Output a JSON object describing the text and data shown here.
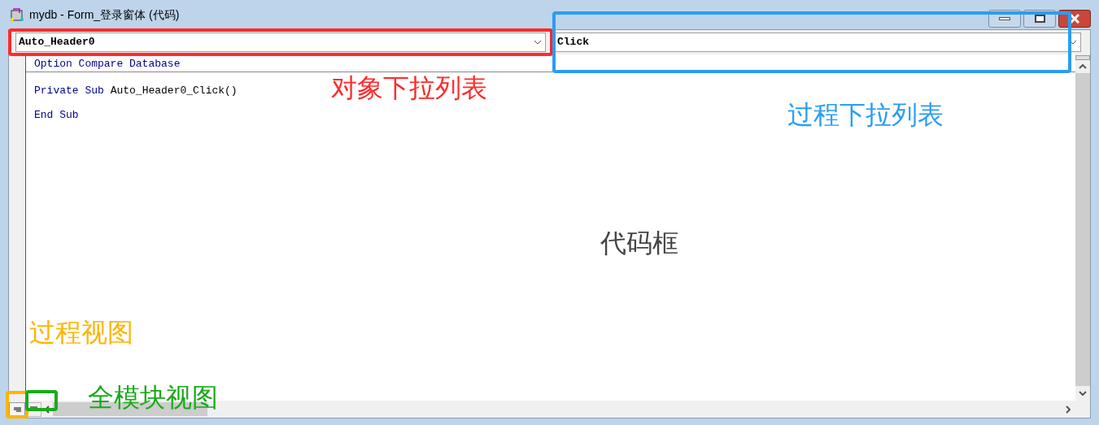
{
  "window": {
    "title": "mydb - Form_登录窗体 (代码)"
  },
  "object_dropdown": {
    "value": "Auto_Header0"
  },
  "procedure_dropdown": {
    "value": "Click"
  },
  "code": {
    "declarations": [
      {
        "tokens": [
          {
            "text": "Option Compare Database",
            "kind": "keyword"
          }
        ]
      }
    ],
    "lines": [
      {
        "tokens": [
          {
            "text": "Private Sub",
            "kind": "keyword"
          },
          {
            "text": " Auto_Header0_Click()",
            "kind": "plain"
          }
        ]
      },
      {
        "tokens": [
          {
            "text": "End Sub",
            "kind": "keyword"
          }
        ]
      }
    ]
  },
  "annotations": [
    {
      "text": "对象下拉列表",
      "color": "#ff2a2a",
      "kind": "object"
    },
    {
      "text": "过程下拉列表",
      "color": "#2a9df4",
      "kind": "procedure"
    },
    {
      "text": "代码框",
      "color": "#444444",
      "kind": "code"
    },
    {
      "text": "过程视图",
      "color": "#ffb400",
      "kind": "procedure_view"
    },
    {
      "text": "全模块视图",
      "color": "#1aaa1a",
      "kind": "module_view"
    }
  ]
}
